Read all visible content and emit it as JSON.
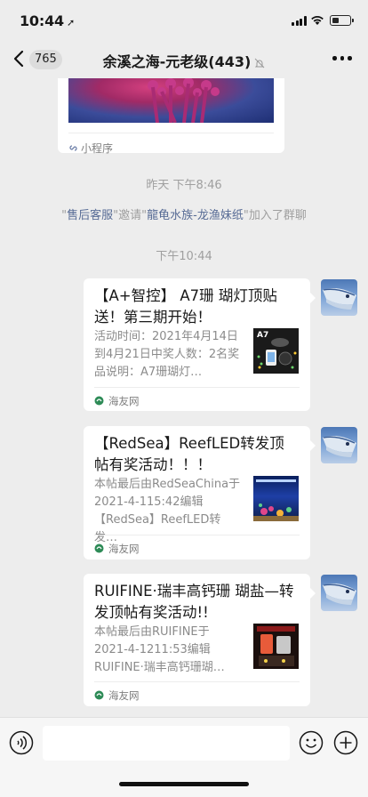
{
  "status": {
    "time": "10:44"
  },
  "nav": {
    "back_count": "765",
    "title": "余溪之海-元老级(443)"
  },
  "partial_card": {
    "mini_label": "小程序"
  },
  "timestamps": {
    "first": "昨天 下午8:46",
    "second": "下午10:44"
  },
  "system_message": {
    "q1": "\"",
    "inviter": "售后客服",
    "q2": "\"邀请\"",
    "invitee": "龍龟水族-龙渔妹纸",
    "q3": "\"加入了群聊"
  },
  "cards": [
    {
      "title": "【A+智控】 A7珊 瑚灯顶贴送！第三期开始！",
      "desc": "活动时间：2021年4月14日到4月21日中奖人数：2名奖品说明：A7珊瑚灯…",
      "thumb_text": "A7",
      "source": "海友网"
    },
    {
      "title": "【RedSea】ReefLED转发顶帖有奖活动！！！",
      "desc": "本帖最后由RedSeaChina于2021-4-115:42编辑【RedSea】ReefLED转发…",
      "source": "海友网"
    },
    {
      "title": "RUIFINE·瑞丰高钙珊 瑚盐—转发顶帖有奖活动!!",
      "desc": "本帖最后由RUIFINE于2021-4-1211:53编辑RUIFINE·瑞丰高钙珊瑚…",
      "source": "海友网"
    }
  ],
  "colors": {
    "link": "#576b95",
    "background": "#ededed",
    "card": "#ffffff"
  }
}
